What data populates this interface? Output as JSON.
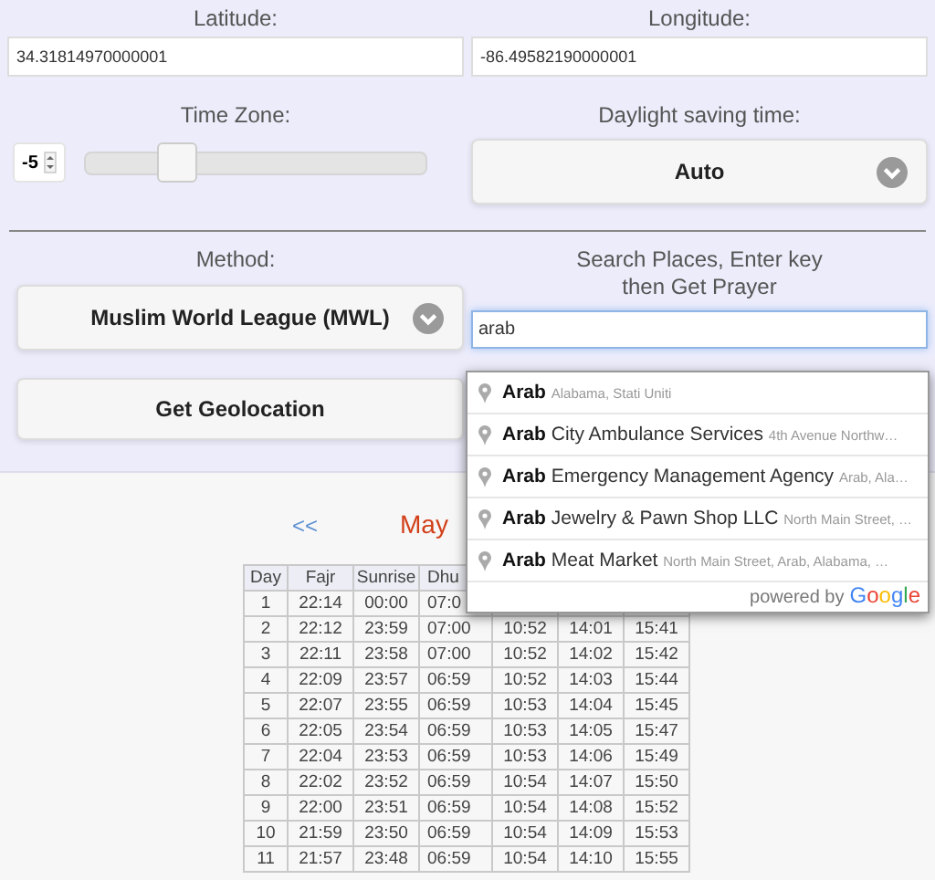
{
  "location": {
    "latitude_label": "Latitude:",
    "latitude": "34.31814970000001",
    "longitude_label": "Longitude:",
    "longitude": "-86.49582190000001"
  },
  "time_zone": {
    "label": "Time Zone:",
    "value": "-5",
    "level": 0.27
  },
  "daylight": {
    "label": "Daylight saving time:",
    "value": "Auto"
  },
  "method": {
    "label": "Method:",
    "value": "Muslim World League (MWL)"
  },
  "search": {
    "label": "Search Places, Enter key then Get Prayer",
    "value": "arab"
  },
  "geolocation_button": "Get Geolocation",
  "suggestions": [
    {
      "match": "Arab",
      "secondary": "Alabama, Stati Uniti"
    },
    {
      "match": "Arab",
      "rest": "City Ambulance Services",
      "secondary": "4th Avenue Northw…"
    },
    {
      "match": "Arab",
      "rest": "Emergency Management Agency",
      "secondary": "Arab, Ala…"
    },
    {
      "match": "Arab",
      "rest": "Jewelry & Pawn Shop LLC",
      "secondary": "North Main Street, …"
    },
    {
      "match": "Arab",
      "rest": "Meat Market",
      "secondary": "North Main Street, Arab, Alabama, …"
    }
  ],
  "attribution": {
    "text": "powered by",
    "logo": "Google"
  },
  "calendar": {
    "prev": "<<",
    "month": "May",
    "columns": [
      "Day",
      "Fajr",
      "Sunrise",
      "Dhu"
    ],
    "rows": [
      [
        "1",
        "22:14",
        "00:00",
        "07:0"
      ],
      [
        "2",
        "22:12",
        "23:59",
        "07:00",
        "10:52",
        "14:01",
        "15:41"
      ],
      [
        "3",
        "22:11",
        "23:58",
        "07:00",
        "10:52",
        "14:02",
        "15:42"
      ],
      [
        "4",
        "22:09",
        "23:57",
        "06:59",
        "10:52",
        "14:03",
        "15:44"
      ],
      [
        "5",
        "22:07",
        "23:55",
        "06:59",
        "10:53",
        "14:04",
        "15:45"
      ],
      [
        "6",
        "22:05",
        "23:54",
        "06:59",
        "10:53",
        "14:05",
        "15:47"
      ],
      [
        "7",
        "22:04",
        "23:53",
        "06:59",
        "10:53",
        "14:06",
        "15:49"
      ],
      [
        "8",
        "22:02",
        "23:52",
        "06:59",
        "10:54",
        "14:07",
        "15:50"
      ],
      [
        "9",
        "22:00",
        "23:51",
        "06:59",
        "10:54",
        "14:08",
        "15:52"
      ],
      [
        "10",
        "21:59",
        "23:50",
        "06:59",
        "10:54",
        "14:09",
        "15:53"
      ],
      [
        "11",
        "21:57",
        "23:48",
        "06:59",
        "10:54",
        "14:10",
        "15:55"
      ]
    ]
  }
}
